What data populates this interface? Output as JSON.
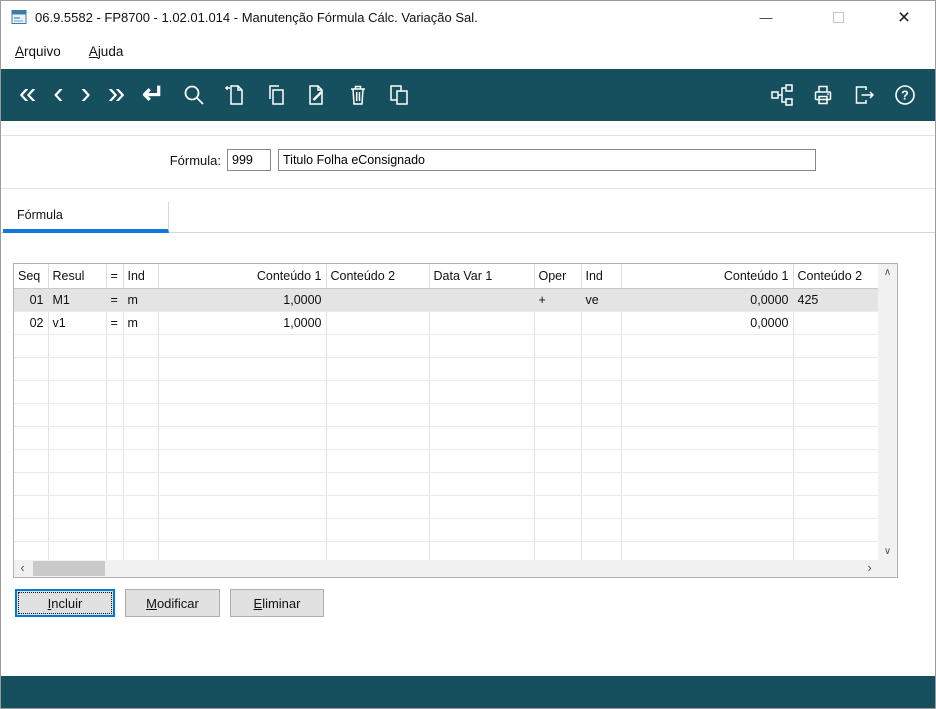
{
  "colors": {
    "toolbar_bg": "#16505F",
    "footer_bg": "#16505F",
    "active_tab_underline": "#1177D7",
    "selected_row_bg": "#E4E4E4",
    "focused_button_border": "#0078D7"
  },
  "window": {
    "title": "06.9.5582 - FP8700 - 1.02.01.014 - Manutenção Fórmula Cálc. Variação Sal.",
    "minimize_glyph": "—",
    "close_glyph": "×"
  },
  "menubar": {
    "items": [
      {
        "label": "Arquivo",
        "mnemonic": "A",
        "rest": "rquivo"
      },
      {
        "label": "Ajuda",
        "mnemonic": "A",
        "rest": "juda"
      }
    ]
  },
  "toolbar": {
    "nav_glyphs": {
      "first": "«",
      "previous": "‹",
      "next": "›",
      "last": "»",
      "go": "↵"
    },
    "icon_names": [
      "first-record",
      "previous-record",
      "next-record",
      "last-record",
      "go-to-record",
      "search",
      "new-record",
      "copy-record",
      "edit-record",
      "delete-record",
      "paste-record",
      "related-programs",
      "print",
      "exit",
      "help"
    ]
  },
  "form": {
    "formula_label": "Fórmula:",
    "formula_code": "999",
    "formula_title": "Titulo Folha eConsignado"
  },
  "tabs": [
    {
      "label": "Fórmula",
      "active": true
    }
  ],
  "grid": {
    "columns": [
      "Seq",
      "Resul",
      "=",
      "Ind",
      "Conteúdo 1",
      "Conteúdo 2",
      "Data Var 1",
      "Oper",
      "Ind",
      "Conteúdo 1",
      "Conteúdo 2"
    ],
    "rows": [
      [
        "01",
        "M1",
        "=",
        "m",
        "1,0000",
        "",
        "",
        "+",
        "ve",
        "0,0000",
        "425"
      ],
      [
        "02",
        "v1",
        "=",
        "m",
        "1,0000",
        "",
        "",
        "",
        "",
        "0,0000",
        ""
      ]
    ],
    "selected_row": 0,
    "empty_rows": 10
  },
  "scrollbar": {
    "up": "∧",
    "down": "∨",
    "left": "‹",
    "right": "›"
  },
  "buttons": [
    {
      "label": "Incluir",
      "mnemonic": "I",
      "rest": "ncluir"
    },
    {
      "label": "Modificar",
      "mnemonic": "M",
      "rest": "odificar"
    },
    {
      "label": "Eliminar",
      "mnemonic": "E",
      "rest": "liminar"
    }
  ]
}
